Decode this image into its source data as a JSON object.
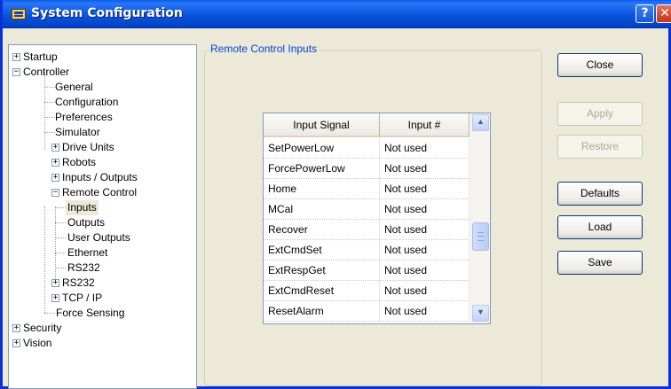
{
  "window": {
    "title": "System Configuration",
    "help_glyph": "?",
    "close_glyph": "✕"
  },
  "tree": {
    "items": [
      {
        "label": "Startup",
        "expander": "+"
      },
      {
        "label": "Controller",
        "expander": "−"
      },
      {
        "label": "General"
      },
      {
        "label": "Configuration"
      },
      {
        "label": "Preferences"
      },
      {
        "label": "Simulator"
      },
      {
        "label": "Drive Units",
        "expander": "+"
      },
      {
        "label": "Robots",
        "expander": "+"
      },
      {
        "label": "Inputs / Outputs",
        "expander": "+"
      },
      {
        "label": "Remote Control",
        "expander": "−"
      },
      {
        "label": "Inputs",
        "selected": true
      },
      {
        "label": "Outputs"
      },
      {
        "label": "User Outputs"
      },
      {
        "label": "Ethernet"
      },
      {
        "label": "RS232"
      },
      {
        "label": "RS232",
        "expander": "+"
      },
      {
        "label": "TCP / IP",
        "expander": "+"
      },
      {
        "label": "Force Sensing"
      },
      {
        "label": "Security",
        "expander": "+"
      },
      {
        "label": "Vision",
        "expander": "+"
      }
    ]
  },
  "group": {
    "label": "Remote Control Inputs"
  },
  "grid": {
    "columns": [
      "Input Signal",
      "Input #"
    ],
    "rows": [
      [
        "SetPowerLow",
        "Not used"
      ],
      [
        "ForcePowerLow",
        "Not used"
      ],
      [
        "Home",
        "Not used"
      ],
      [
        "MCal",
        "Not used"
      ],
      [
        "Recover",
        "Not used"
      ],
      [
        "ExtCmdSet",
        "Not used"
      ],
      [
        "ExtRespGet",
        "Not used"
      ],
      [
        "ExtCmdReset",
        "Not used"
      ],
      [
        "ResetAlarm",
        "Not used"
      ]
    ],
    "scroll_up": "▲",
    "scroll_down": "▼"
  },
  "buttons": {
    "close": "Close",
    "apply": "Apply",
    "restore": "Restore",
    "defaults": "Defaults",
    "load": "Load",
    "save": "Save"
  },
  "colors": {
    "title_bar": "#0a5cf0",
    "group_label": "#0046d5",
    "disabled_text": "#aca899"
  }
}
